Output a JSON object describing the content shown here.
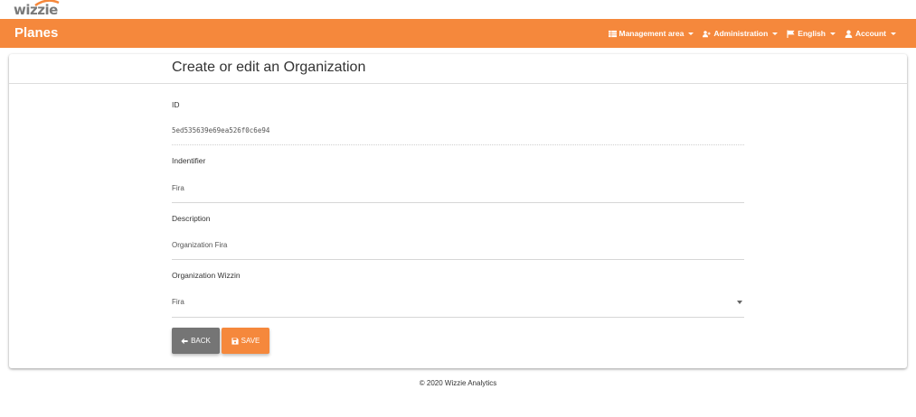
{
  "brand": {
    "logo_text": "wizzie"
  },
  "header": {
    "app_title": "Planes",
    "menu": [
      {
        "label": "Management area",
        "icon": "table-icon"
      },
      {
        "label": "Administration",
        "icon": "user-plus-icon"
      },
      {
        "label": "English",
        "icon": "flag-icon"
      },
      {
        "label": "Account",
        "icon": "user-icon"
      }
    ]
  },
  "form": {
    "title": "Create or edit an Organization",
    "fields": {
      "id": {
        "label": "ID",
        "value": "5ed535639e69ea526f0c6e94"
      },
      "identifier": {
        "label": "Indentifier",
        "value": "Fira"
      },
      "description": {
        "label": "Description",
        "value": "Organization Fira"
      },
      "wizzin": {
        "label": "Organization Wizzin",
        "value": "Fira"
      }
    },
    "buttons": {
      "back": "BACK",
      "save": "SAVE"
    }
  },
  "footer": {
    "text": "© 2020 Wizzie Analytics"
  },
  "colors": {
    "accent": "#f5883c",
    "back_button": "#757575"
  }
}
